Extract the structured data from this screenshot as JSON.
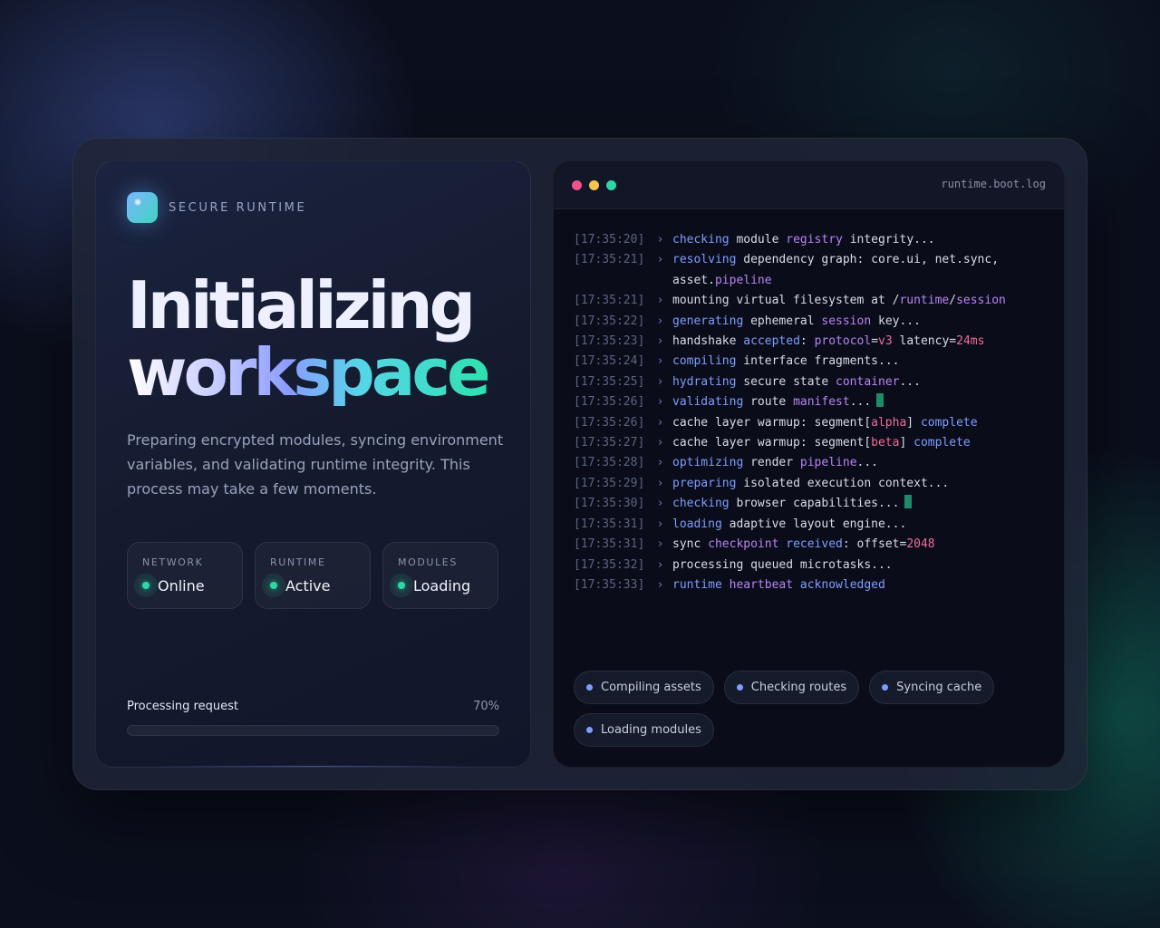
{
  "brand": {
    "name": "SECURE RUNTIME"
  },
  "headline": {
    "line1": "Initializing",
    "line2": "workspace"
  },
  "description": "Preparing encrypted modules, syncing environment variables, and validating runtime integrity. This process may take a few moments.",
  "stats": [
    {
      "label": "NETWORK",
      "value": "Online"
    },
    {
      "label": "RUNTIME",
      "value": "Active"
    },
    {
      "label": "MODULES",
      "value": "Loading"
    }
  ],
  "progress": {
    "label": "Processing request",
    "percent_text": "70%",
    "fill_fraction": 0.0
  },
  "terminal": {
    "filename": "runtime.boot.log",
    "arrow": "›",
    "lines": [
      {
        "ts": "[17:35:20]",
        "parts": [
          [
            "kw",
            "checking"
          ],
          [
            "t",
            " module "
          ],
          [
            "pp",
            "registry"
          ],
          [
            "t",
            " integrity..."
          ]
        ]
      },
      {
        "ts": "[17:35:21]",
        "parts": [
          [
            "kw",
            "resolving"
          ],
          [
            "t",
            " dependency graph: core.ui, net.sync, asset."
          ],
          [
            "pp",
            "pipeline"
          ]
        ]
      },
      {
        "ts": "[17:35:21]",
        "parts": [
          [
            "t",
            "mounting virtual filesystem at /"
          ],
          [
            "pp",
            "runtime"
          ],
          [
            "t",
            "/"
          ],
          [
            "pp",
            "session"
          ]
        ]
      },
      {
        "ts": "[17:35:22]",
        "parts": [
          [
            "kw",
            "generating"
          ],
          [
            "t",
            " ephemeral "
          ],
          [
            "pp",
            "session"
          ],
          [
            "t",
            " key..."
          ]
        ]
      },
      {
        "ts": "[17:35:23]",
        "parts": [
          [
            "t",
            "handshake "
          ],
          [
            "kw",
            "accepted"
          ],
          [
            "t",
            ": "
          ],
          [
            "pp",
            "protocol"
          ],
          [
            "t",
            "="
          ],
          [
            "pk",
            "v3"
          ],
          [
            "t",
            " latency="
          ],
          [
            "pk",
            "24ms"
          ]
        ]
      },
      {
        "ts": "[17:35:24]",
        "parts": [
          [
            "kw",
            "compiling"
          ],
          [
            "t",
            " interface fragments..."
          ]
        ]
      },
      {
        "ts": "[17:35:25]",
        "parts": [
          [
            "kw",
            "hydrating"
          ],
          [
            "t",
            " secure state "
          ],
          [
            "pp",
            "container"
          ],
          [
            "t",
            "..."
          ]
        ]
      },
      {
        "ts": "[17:35:26]",
        "parts": [
          [
            "kw",
            "validating"
          ],
          [
            "t",
            " route "
          ],
          [
            "pp",
            "manifest"
          ],
          [
            "t",
            "..."
          ]
        ],
        "cursor": true
      },
      {
        "ts": "[17:35:26]",
        "parts": [
          [
            "t",
            "cache layer warmup: segment["
          ],
          [
            "pk",
            "alpha"
          ],
          [
            "t",
            "] "
          ],
          [
            "kw",
            "complete"
          ]
        ]
      },
      {
        "ts": "[17:35:27]",
        "parts": [
          [
            "t",
            "cache layer warmup: segment["
          ],
          [
            "pk",
            "beta"
          ],
          [
            "t",
            "] "
          ],
          [
            "kw",
            "complete"
          ]
        ]
      },
      {
        "ts": "[17:35:28]",
        "parts": [
          [
            "kw",
            "optimizing"
          ],
          [
            "t",
            " render "
          ],
          [
            "pp",
            "pipeline"
          ],
          [
            "t",
            "..."
          ]
        ]
      },
      {
        "ts": "[17:35:29]",
        "parts": [
          [
            "kw",
            "preparing"
          ],
          [
            "t",
            " isolated execution context..."
          ]
        ]
      },
      {
        "ts": "[17:35:30]",
        "parts": [
          [
            "kw",
            "checking"
          ],
          [
            "t",
            " browser capabilities..."
          ]
        ],
        "cursor": true
      },
      {
        "ts": "[17:35:31]",
        "parts": [
          [
            "kw",
            "loading"
          ],
          [
            "t",
            " adaptive layout engine..."
          ]
        ]
      },
      {
        "ts": "[17:35:31]",
        "parts": [
          [
            "t",
            "sync "
          ],
          [
            "pp",
            "checkpoint"
          ],
          [
            "t",
            " "
          ],
          [
            "kw",
            "received"
          ],
          [
            "t",
            ": offset="
          ],
          [
            "pk",
            "2048"
          ]
        ]
      },
      {
        "ts": "[17:35:32]",
        "parts": [
          [
            "t",
            "processing queued microtasks..."
          ]
        ]
      },
      {
        "ts": "[17:35:33]",
        "parts": [
          [
            "kw",
            "runtime"
          ],
          [
            "t",
            " "
          ],
          [
            "pp",
            "heartbeat"
          ],
          [
            "t",
            " "
          ],
          [
            "kw",
            "acknowledged"
          ]
        ]
      }
    ],
    "chips": [
      "Compiling assets",
      "Checking routes",
      "Syncing cache",
      "Loading modules"
    ]
  },
  "colors": {
    "accent_green": "#2fd6a6",
    "accent_blue": "#7f9cff",
    "accent_purple": "#b783f5",
    "accent_pink": "#f06b9b"
  },
  "icons": {
    "window_controls": [
      "close-dot-icon",
      "minimize-dot-icon",
      "maximize-dot-icon"
    ],
    "brand": "brand-logo-icon",
    "status": "status-dot-icon",
    "chip": "chip-dot-icon",
    "cursor": "terminal-cursor-icon"
  }
}
